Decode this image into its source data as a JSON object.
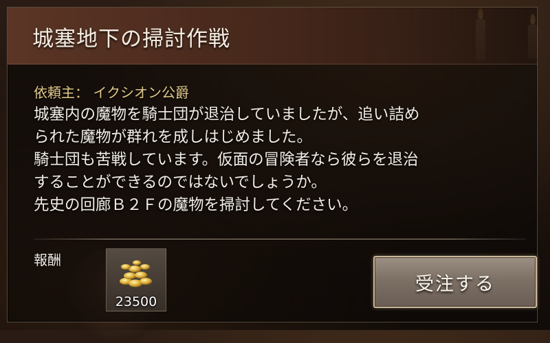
{
  "quest": {
    "title": "城塞地下の掃討作戦",
    "client": "依頼主： イクシオン公爵",
    "description_lines": [
      "城塞内の魔物を騎士団が退治していましたが、追い詰め",
      "られた魔物が群れを成しはじめました。",
      "騎士団も苦戦しています。仮面の冒険者なら彼らを退治",
      "することができるのではないでしょうか。",
      "先史の回廊Ｂ２Ｆの魔物を掃討してください。"
    ]
  },
  "reward": {
    "label": "報酬",
    "item_icon": "gold-coins-icon",
    "amount": "23500"
  },
  "actions": {
    "accept_label": "受注する"
  },
  "colors": {
    "title_bar": "#5f3726",
    "client_text": "#e0c98a",
    "button_border": "#cbb79a"
  }
}
